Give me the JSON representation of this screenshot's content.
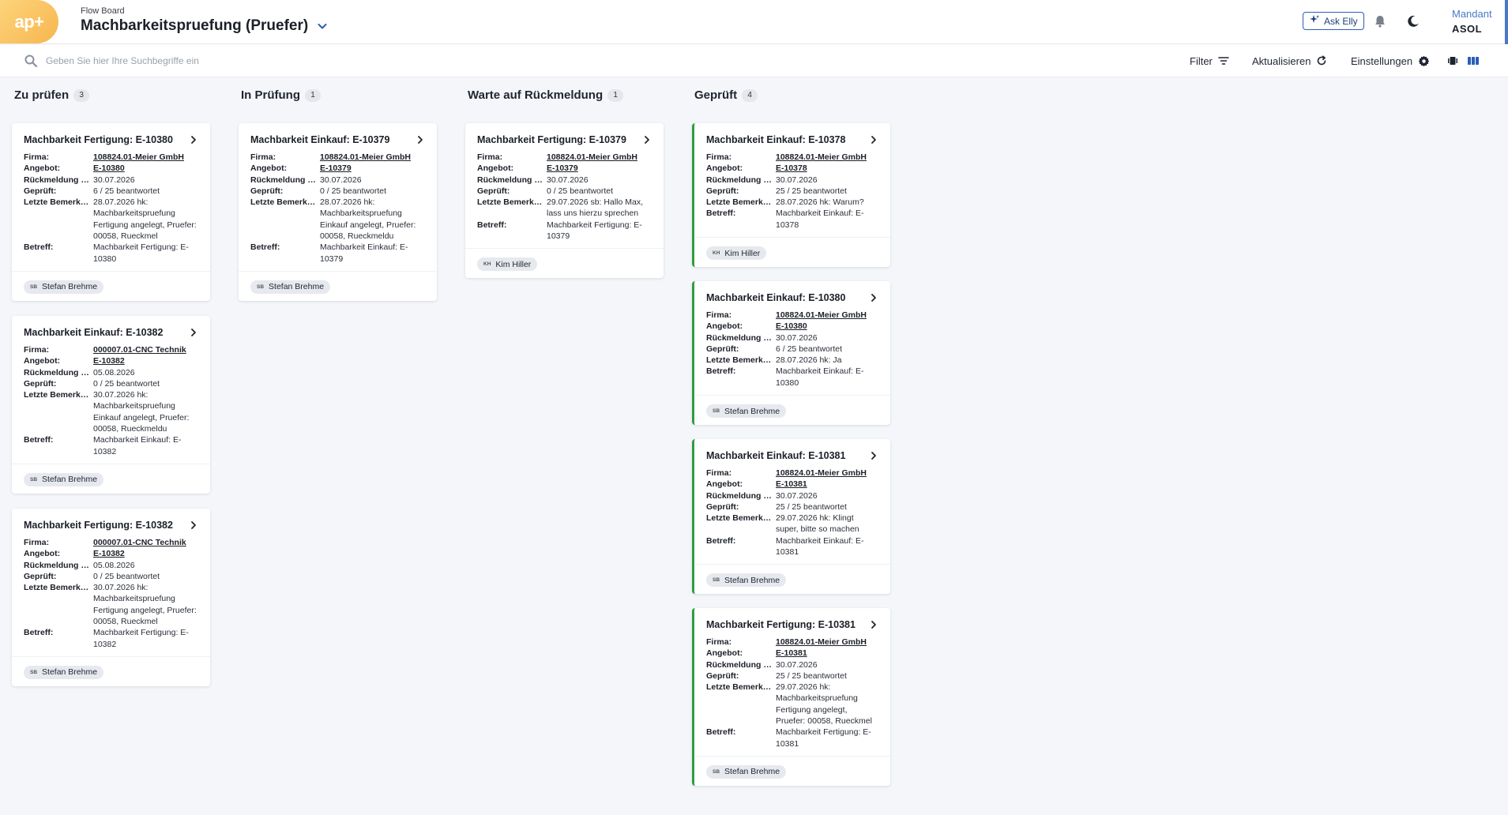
{
  "header": {
    "logo": "ap+",
    "crumb": "Flow Board",
    "title": "Machbarkeitspruefung (Pruefer)",
    "ask_elly": "Ask Elly",
    "mandant_label": "Mandant",
    "mandant_value": "ASOL",
    "icons": [
      "bell-icon",
      "moon-icon"
    ]
  },
  "toolbar": {
    "search_placeholder": "Geben Sie hier Ihre Suchbegriffe ein",
    "filter": "Filter",
    "refresh": "Aktualisieren",
    "settings": "Einstellungen"
  },
  "field_labels": {
    "firma": "Firma:",
    "angebot": "Angebot:",
    "rueckmeldung": "Rückmeldung b...",
    "geprueft": "Geprüft:",
    "bemerkung": "Letzte Bemerku...",
    "betreff": "Betreff:"
  },
  "colors": {
    "accent": "#4a78c6",
    "done_border": "#2e9e3f",
    "logo": "#f7b64f"
  },
  "columns": [
    {
      "title": "Zu prüfen",
      "count": "3",
      "cards": [
        {
          "title": "Machbarkeit Fertigung: E-10380",
          "firma": "108824.01-Meier GmbH",
          "angebot": "E-10380",
          "rueckmeldung": "30.07.2026",
          "geprueft": "6 / 25 beantwortet",
          "bemerkung": "28.07.2026 hk: Machbarkeitspruefung Fertigung angelegt, Pruefer: 00058, Rueckmel",
          "betreff": "Machbarkeit Fertigung: E-10380",
          "user_initials": "SB",
          "user": "Stefan Brehme"
        },
        {
          "title": "Machbarkeit Einkauf: E-10382",
          "firma": "000007.01-CNC Technik",
          "angebot": "E-10382",
          "rueckmeldung": "05.08.2026",
          "geprueft": "0 / 25 beantwortet",
          "bemerkung": "30.07.2026 hk: Machbarkeitspruefung Einkauf angelegt, Pruefer: 00058, Rueckmeldu",
          "betreff": "Machbarkeit Einkauf: E-10382",
          "user_initials": "SB",
          "user": "Stefan Brehme"
        },
        {
          "title": "Machbarkeit Fertigung: E-10382",
          "firma": "000007.01-CNC Technik",
          "angebot": "E-10382",
          "rueckmeldung": "05.08.2026",
          "geprueft": "0 / 25 beantwortet",
          "bemerkung": "30.07.2026 hk: Machbarkeitspruefung Fertigung angelegt, Pruefer: 00058, Rueckmel",
          "betreff": "Machbarkeit Fertigung: E-10382",
          "user_initials": "SB",
          "user": "Stefan Brehme"
        }
      ]
    },
    {
      "title": "In Prüfung",
      "count": "1",
      "cards": [
        {
          "title": "Machbarkeit Einkauf: E-10379",
          "firma": "108824.01-Meier GmbH",
          "angebot": "E-10379",
          "rueckmeldung": "30.07.2026",
          "geprueft": "0 / 25 beantwortet",
          "bemerkung": "28.07.2026 hk: Machbarkeitspruefung Einkauf angelegt, Pruefer: 00058, Rueckmeldu",
          "betreff": "Machbarkeit Einkauf: E-10379",
          "user_initials": "SB",
          "user": "Stefan Brehme"
        }
      ]
    },
    {
      "title": "Warte auf Rückmeldung",
      "count": "1",
      "cards": [
        {
          "title": "Machbarkeit Fertigung: E-10379",
          "firma": "108824.01-Meier GmbH",
          "angebot": "E-10379",
          "rueckmeldung": "30.07.2026",
          "geprueft": "0 / 25 beantwortet",
          "bemerkung": "29.07.2026 sb: Hallo Max, lass uns hierzu sprechen",
          "betreff": "Machbarkeit Fertigung: E-10379",
          "user_initials": "KH",
          "user": "Kim Hiller"
        }
      ]
    },
    {
      "title": "Geprüft",
      "count": "4",
      "cards": [
        {
          "title": "Machbarkeit Einkauf: E-10378",
          "firma": "108824.01-Meier GmbH",
          "angebot": "E-10378",
          "rueckmeldung": "30.07.2026",
          "geprueft": "25 / 25 beantwortet",
          "bemerkung": "28.07.2026 hk: Warum?",
          "betreff": "Machbarkeit Einkauf: E-10378",
          "user_initials": "KH",
          "user": "Kim Hiller"
        },
        {
          "title": "Machbarkeit Einkauf: E-10380",
          "firma": "108824.01-Meier GmbH",
          "angebot": "E-10380",
          "rueckmeldung": "30.07.2026",
          "geprueft": "6 / 25 beantwortet",
          "bemerkung": "28.07.2026 hk: Ja",
          "betreff": "Machbarkeit Einkauf: E-10380",
          "user_initials": "SB",
          "user": "Stefan Brehme"
        },
        {
          "title": "Machbarkeit Einkauf: E-10381",
          "firma": "108824.01-Meier GmbH",
          "angebot": "E-10381",
          "rueckmeldung": "30.07.2026",
          "geprueft": "25 / 25 beantwortet",
          "bemerkung": "29.07.2026 hk: Klingt super, bitte so machen",
          "betreff": "Machbarkeit Einkauf: E-10381",
          "user_initials": "SB",
          "user": "Stefan Brehme"
        },
        {
          "title": "Machbarkeit Fertigung: E-10381",
          "firma": "108824.01-Meier GmbH",
          "angebot": "E-10381",
          "rueckmeldung": "30.07.2026",
          "geprueft": "25 / 25 beantwortet",
          "bemerkung": "29.07.2026 hk: Machbarkeitspruefung Fertigung angelegt, Pruefer: 00058, Rueckmel",
          "betreff": "Machbarkeit Fertigung: E-10381",
          "user_initials": "SB",
          "user": "Stefan Brehme"
        }
      ]
    }
  ]
}
